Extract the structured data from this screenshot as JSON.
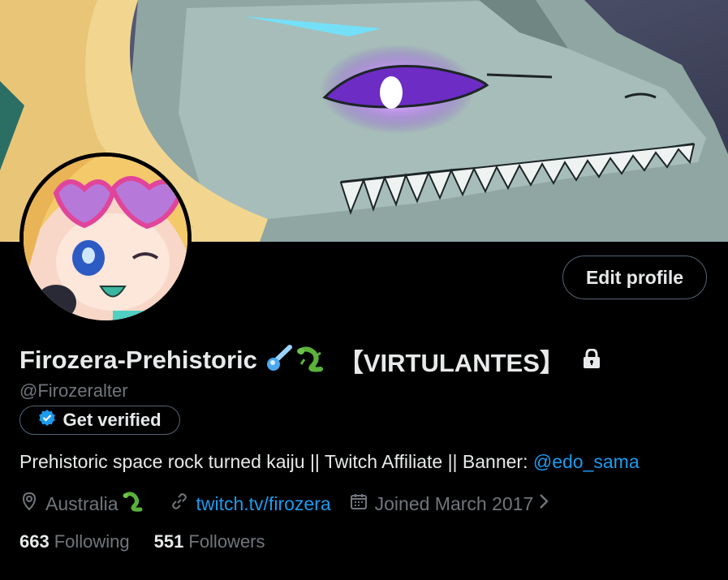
{
  "profile": {
    "display_name": "Firozera-Prehistoric",
    "name_suffix": "【VIRTULANTES】",
    "handle": "@Firozeralter",
    "edit_label": "Edit profile",
    "verify_label": "Get verified",
    "bio_text": "Prehistoric space rock turned kaiju || Twitch Affiliate || Banner: ",
    "bio_mention": "@edo_sama",
    "location": "Australia",
    "website": "twitch.tv/firozera",
    "joined": "Joined March 2017",
    "following_count": "663",
    "following_label": "Following",
    "followers_count": "551",
    "followers_label": "Followers"
  },
  "icons": {
    "comet": "comet-emoji",
    "lizard": "lizard-emoji",
    "lock": "lock-icon",
    "verified": "verified-badge-icon",
    "location": "location-pin-icon",
    "link": "link-icon",
    "calendar": "calendar-icon",
    "chevron": "chevron-right-icon"
  },
  "colors": {
    "background": "#000000",
    "text": "#e7e9ea",
    "secondary": "#71767b",
    "accent": "#1d9bf0",
    "border": "#536471"
  }
}
